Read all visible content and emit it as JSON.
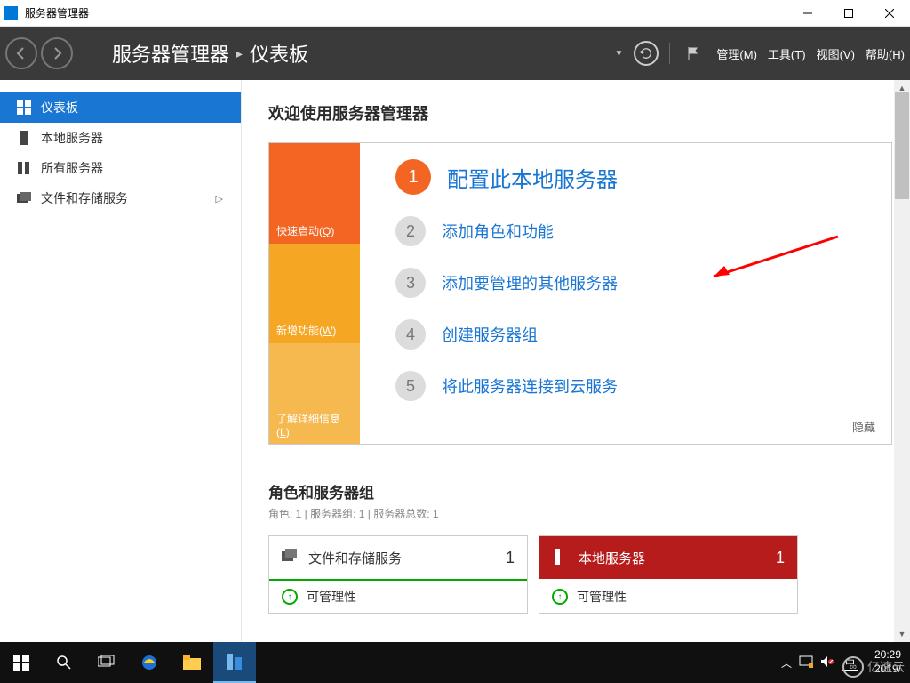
{
  "titlebar": {
    "app_name": "服务器管理器"
  },
  "header": {
    "breadcrumb_app": "服务器管理器",
    "breadcrumb_page": "仪表板",
    "menu": {
      "manage": "管理(M)",
      "tools": "工具(T)",
      "view": "视图(V)",
      "help": "帮助(H)"
    }
  },
  "sidebar": {
    "items": [
      {
        "label": "仪表板"
      },
      {
        "label": "本地服务器"
      },
      {
        "label": "所有服务器"
      },
      {
        "label": "文件和存储服务"
      }
    ]
  },
  "welcome": {
    "title": "欢迎使用服务器管理器",
    "tiles": {
      "quickstart": "快速启动(Q)",
      "whatsnew": "新增功能(W)",
      "learnmore": "了解详细信息(L)"
    },
    "steps": [
      "配置此本地服务器",
      "添加角色和功能",
      "添加要管理的其他服务器",
      "创建服务器组",
      "将此服务器连接到云服务"
    ],
    "hide": "隐藏"
  },
  "roles": {
    "title": "角色和服务器组",
    "subtitle": "角色: 1 | 服务器组: 1 | 服务器总数: 1",
    "tiles": [
      {
        "title": "文件和存储服务",
        "count": "1",
        "row": "可管理性"
      },
      {
        "title": "本地服务器",
        "count": "1",
        "row": "可管理性"
      }
    ]
  },
  "taskbar": {
    "time": "20:29",
    "date": "2019/",
    "ime": "中"
  },
  "watermark": "亿速云"
}
